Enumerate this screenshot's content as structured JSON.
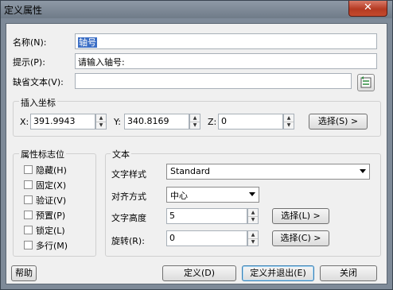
{
  "window": {
    "title": "定义属性",
    "close_glyph": "✕"
  },
  "attribute": {
    "tag_label": "名称(N):",
    "tag_value": "轴号",
    "prompt_label": "提示(P):",
    "prompt_value": "请输入轴号:",
    "default_label": "缺省文本(V):",
    "default_value": ""
  },
  "insert_point": {
    "group_label": "插入坐标",
    "x_label": "X:",
    "x_value": "391.9943",
    "y_label": "Y:",
    "y_value": "340.8169",
    "z_label": "Z:",
    "z_value": "0",
    "pick_button": "选择(S) >"
  },
  "mode": {
    "group_label": "属性标志位",
    "options": [
      "隐藏(H)",
      "固定(X)",
      "验证(V)",
      "预置(P)",
      "锁定(L)",
      "多行(M)"
    ]
  },
  "text": {
    "group_label": "文本",
    "style_label": "文字样式",
    "style_value": "Standard",
    "justify_label": "对齐方式",
    "justify_value": "中心",
    "height_label": "文字高度",
    "height_value": "5",
    "height_pick": "选择(L) >",
    "rotation_label": "旋转(R):",
    "rotation_value": "0",
    "rotation_pick": "选择(C) >"
  },
  "buttons": {
    "help": "帮助",
    "define": "定义(D)",
    "define_exit": "定义并退出(E)",
    "close": "关闭"
  },
  "icons": {
    "field_insert": "insert-field-icon"
  }
}
